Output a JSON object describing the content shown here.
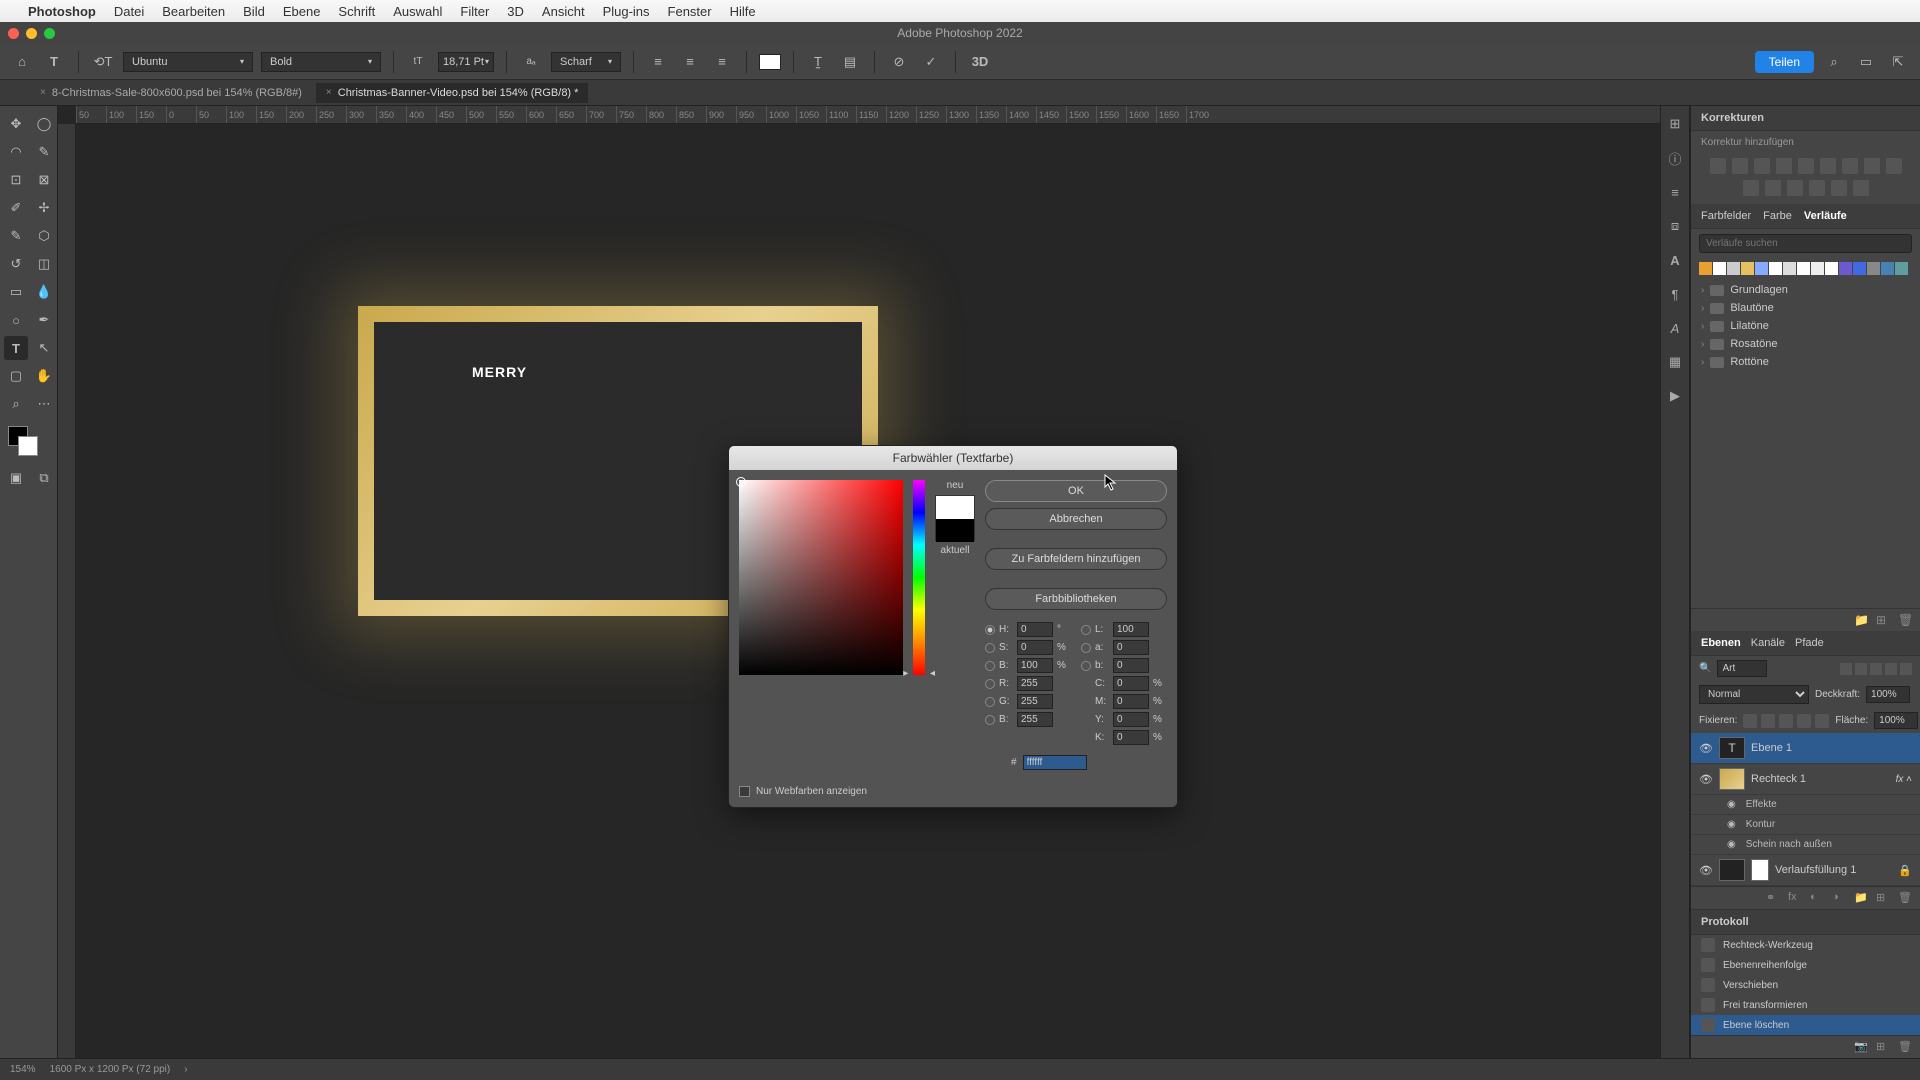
{
  "menubar": {
    "app": "Photoshop",
    "items": [
      "Datei",
      "Bearbeiten",
      "Bild",
      "Ebene",
      "Schrift",
      "Auswahl",
      "Filter",
      "3D",
      "Ansicht",
      "Plug-ins",
      "Fenster",
      "Hilfe"
    ]
  },
  "window_title": "Adobe Photoshop 2022",
  "options": {
    "font": "Ubuntu",
    "weight": "Bold",
    "size": "18,71 Pt",
    "aa": "Scharf"
  },
  "share": "Teilen",
  "tabs": [
    {
      "label": "8-Christmas-Sale-800x600.psd bei 154% (RGB/8#)",
      "active": false
    },
    {
      "label": "Christmas-Banner-Video.psd bei 154% (RGB/8) *",
      "active": true
    }
  ],
  "ruler": [
    "50",
    "100",
    "150",
    "0",
    "50",
    "100",
    "150",
    "200",
    "250",
    "300",
    "350",
    "400",
    "450",
    "500",
    "550",
    "600",
    "650",
    "700",
    "750",
    "800",
    "850",
    "900",
    "950",
    "1000",
    "1050",
    "1100",
    "1150",
    "1200",
    "1250",
    "1300",
    "1350",
    "1400",
    "1450",
    "1500",
    "1550",
    "1600",
    "1650",
    "1700"
  ],
  "canvas_text": "MERRY",
  "korrekturen": {
    "title": "Korrekturen",
    "sub": "Korrektur hinzufügen"
  },
  "grad_tabs": {
    "farbfelder": "Farbfelder",
    "farbe": "Farbe",
    "verlaufe": "Verläufe"
  },
  "grad_search": "Verläufe suchen",
  "grad_folders": [
    "Grundlagen",
    "Blautöne",
    "Lilatöne",
    "Rosatöne",
    "Rottöne"
  ],
  "grad_colors": [
    "#e8a030",
    "#fff",
    "#ccc",
    "#e8c060",
    "#88aaff",
    "#fff",
    "#ddd",
    "#fff",
    "#eee",
    "#fff",
    "#6a5acd",
    "#4169e1",
    "#888",
    "#4682b4",
    "#5f9ea0"
  ],
  "layer_tabs": {
    "ebenen": "Ebenen",
    "kanale": "Kanäle",
    "pfade": "Pfade"
  },
  "layer_search": "Art",
  "blend": {
    "mode": "Normal",
    "opacity_label": "Deckkraft:",
    "opacity": "100%"
  },
  "lock": {
    "label": "Fixieren:",
    "fill_label": "Fläche:",
    "fill": "100%"
  },
  "layers": [
    {
      "name": "Ebene 1",
      "type": "text",
      "selected": true
    },
    {
      "name": "Rechteck 1",
      "type": "shape",
      "fx": true
    },
    {
      "name": "Verlaufsfüllung 1",
      "type": "fill",
      "locked": true
    }
  ],
  "effects": {
    "label": "Effekte",
    "items": [
      "Kontur",
      "Schein nach außen"
    ]
  },
  "protokoll": {
    "title": "Protokoll",
    "items": [
      "Rechteck-Werkzeug",
      "Ebenenreihenfolge",
      "Verschieben",
      "Frei transformieren",
      "Ebene löschen"
    ],
    "selected": 4
  },
  "status": {
    "zoom": "154%",
    "dims": "1600 Px x 1200 Px (72 ppi)"
  },
  "dialog": {
    "title": "Farbwähler (Textfarbe)",
    "neu": "neu",
    "aktuell": "aktuell",
    "ok": "OK",
    "cancel": "Abbrechen",
    "add": "Zu Farbfeldern hinzufügen",
    "libs": "Farbbibliotheken",
    "web": "Nur Webfarben anzeigen",
    "H": "0",
    "S": "0",
    "Bv": "100",
    "R": "255",
    "G": "255",
    "Bb": "255",
    "L": "100",
    "a": "0",
    "b": "0",
    "C": "0",
    "M": "0",
    "Y": "0",
    "K": "0",
    "hex": "ffffff"
  }
}
